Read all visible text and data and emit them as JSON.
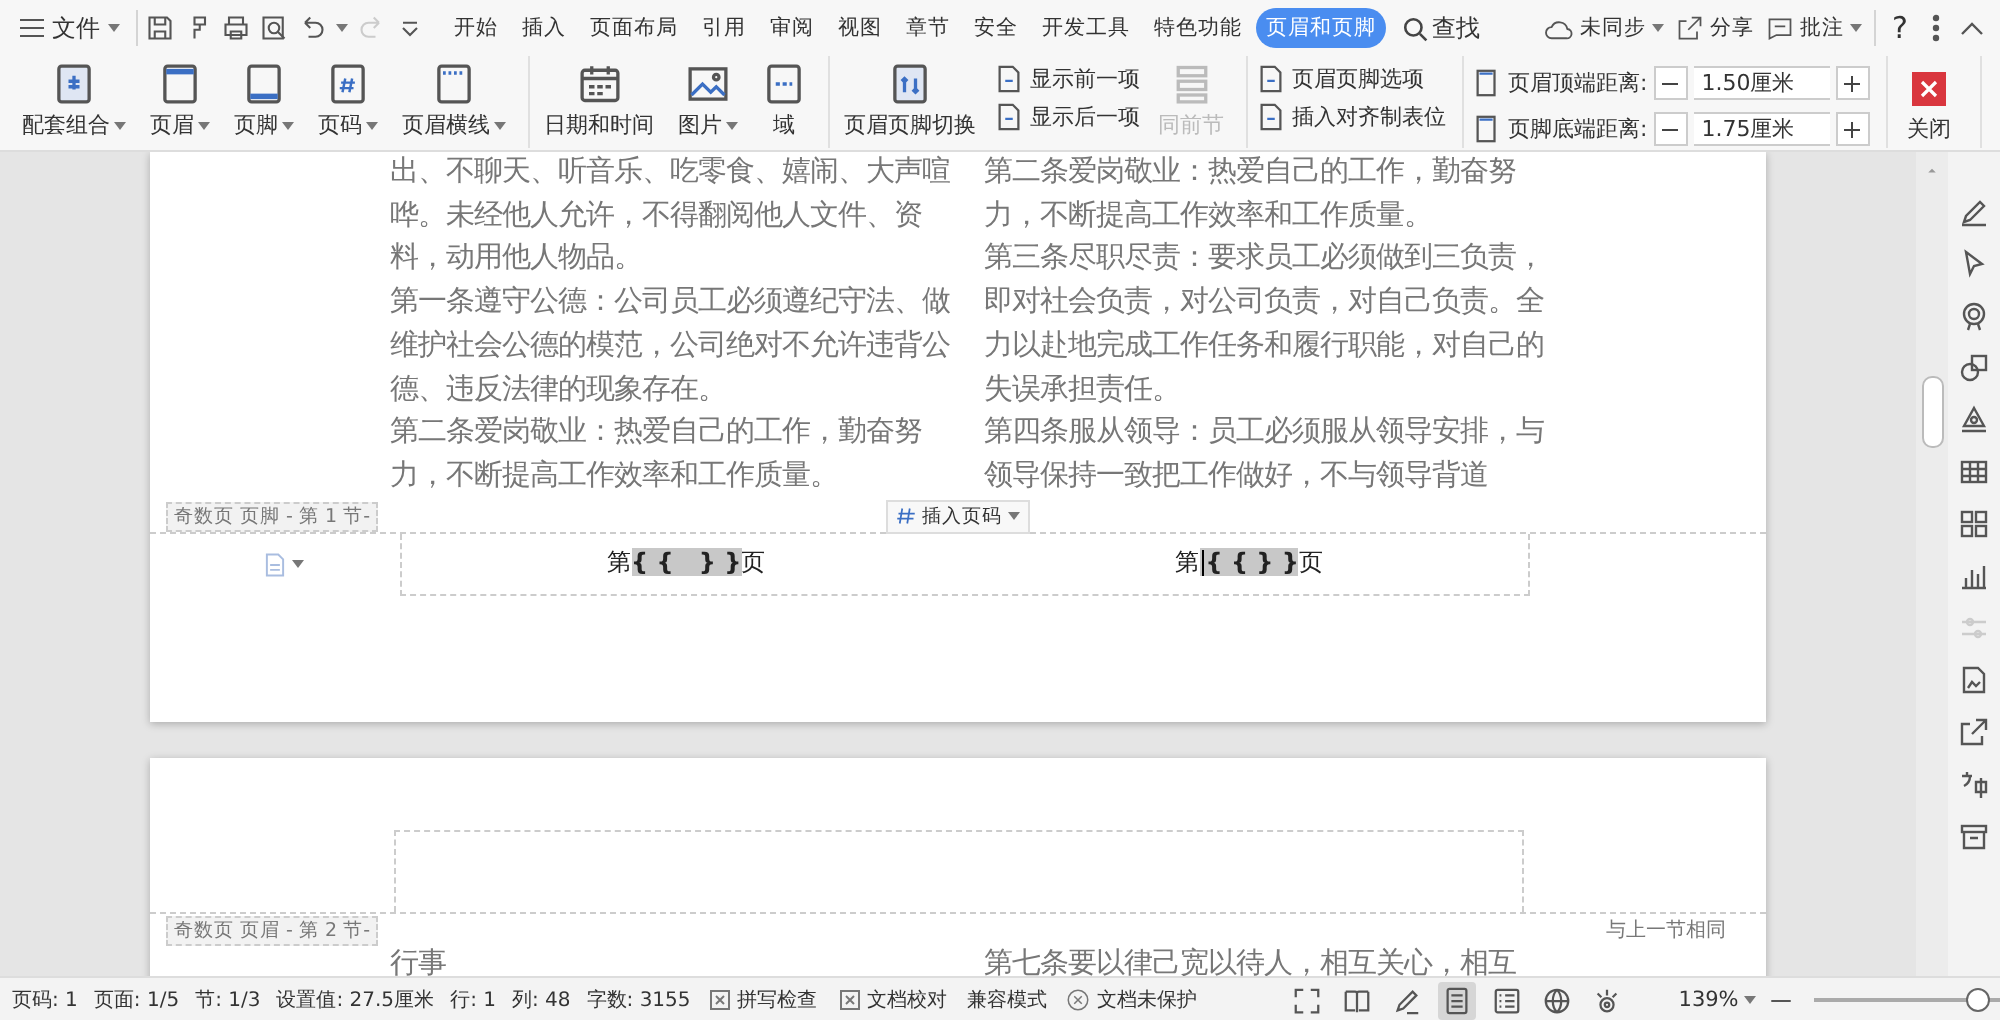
{
  "menu": {
    "file_label": "文件",
    "tabs": [
      {
        "label": "开始",
        "selected": false
      },
      {
        "label": "插入",
        "selected": false
      },
      {
        "label": "页面布局",
        "selected": false
      },
      {
        "label": "引用",
        "selected": false
      },
      {
        "label": "审阅",
        "selected": false
      },
      {
        "label": "视图",
        "selected": false
      },
      {
        "label": "章节",
        "selected": false
      },
      {
        "label": "安全",
        "selected": false
      },
      {
        "label": "开发工具",
        "selected": false
      },
      {
        "label": "特色功能",
        "selected": false
      },
      {
        "label": "页眉和页脚",
        "selected": true
      }
    ],
    "find_label": "查找",
    "sync_label": "未同步",
    "share_label": "分享",
    "comment_label": "批注",
    "help_glyph": "?"
  },
  "ribbon": {
    "groups": [
      {
        "items": [
          {
            "kind": "big",
            "label": "配套组合",
            "dropdown": true,
            "disabled": false
          },
          {
            "kind": "big",
            "label": "页眉",
            "dropdown": true,
            "disabled": false
          },
          {
            "kind": "big",
            "label": "页脚",
            "dropdown": true,
            "disabled": false
          },
          {
            "kind": "big",
            "label": "页码",
            "dropdown": true,
            "disabled": false
          },
          {
            "kind": "big",
            "label": "页眉横线",
            "dropdown": true,
            "disabled": false
          }
        ]
      },
      {
        "items": [
          {
            "kind": "big",
            "label": "日期和时间",
            "dropdown": false,
            "disabled": false
          },
          {
            "kind": "big",
            "label": "图片",
            "dropdown": true,
            "disabled": false
          },
          {
            "kind": "big",
            "label": "域",
            "dropdown": false,
            "disabled": false
          }
        ]
      },
      {
        "items": [
          {
            "kind": "big",
            "label": "页眉页脚切换",
            "dropdown": false,
            "disabled": false
          },
          {
            "kind": "stack",
            "buttons": [
              {
                "label": "显示前一项",
                "disabled": false
              },
              {
                "label": "显示后一项",
                "disabled": false
              }
            ]
          },
          {
            "kind": "big",
            "label": "同前节",
            "dropdown": false,
            "disabled": true
          }
        ]
      },
      {
        "items": [
          {
            "kind": "stack",
            "buttons": [
              {
                "label": "页眉页脚选项",
                "disabled": false
              },
              {
                "label": "插入对齐制表位",
                "disabled": false
              }
            ]
          }
        ]
      },
      {
        "items": [
          {
            "kind": "spin",
            "rows": [
              {
                "label": "页眉顶端距离:",
                "value": "1.50厘米"
              },
              {
                "label": "页脚底端距离:",
                "value": "1.75厘米"
              }
            ]
          }
        ]
      },
      {
        "items": [
          {
            "kind": "close",
            "label": "关闭"
          }
        ]
      }
    ]
  },
  "page1": {
    "left_paragraphs": [
      "出、不聊天、听音乐、吃零食、嬉闹、大声喧哗。未经他人允许，不得翻阅他人文件、资料，动用他人物品。",
      "第一条遵守公德：公司员工必须遵纪守法、做维护社会公德的模范，公司绝对不允许违背公德、违反法律的现象存在。",
      "第二条爱岗敬业：热爱自己的工作，勤奋努力，不断提高工作效率和工作质量。"
    ],
    "right_paragraphs": [
      "第二条爱岗敬业：热爱自己的工作，勤奋努力，不断提高工作效率和工作质量。",
      "第三条尽职尽责：要求员工必须做到三负责，即对社会负责，对公司负责，对自己负责。全力以赴地完成工作任务和履行职能，对自己的失误承担责任。",
      "第四条服从领导：员工必须服从领导安排，与领导保持一致把工作做好，不与领导背道"
    ],
    "footer_label": "奇数页 页脚 - 第 1 节-",
    "insert_page_number": "插入页码",
    "page_fields": [
      {
        "prefix": "第",
        "field": "{ {   } }",
        "suffix": "页",
        "text_cursor": false
      },
      {
        "prefix": "第",
        "field": "{ { } }",
        "suffix": "页",
        "text_cursor": true
      }
    ]
  },
  "page2": {
    "header_label": "奇数页 页眉 - 第 2 节-",
    "same_as_previous": "与上一节相同",
    "left_text": "行事",
    "right_text": "第七条要以律己宽以待人，相互关心，相互"
  },
  "status_bar": {
    "items": [
      "页码: 1",
      "页面: 1/5",
      "节: 1/3",
      "设置值: 27.5厘米",
      "行: 1",
      "列: 48",
      "字数: 3155"
    ],
    "checks": [
      "拼写检查",
      "文档校对"
    ],
    "mode": "兼容模式",
    "protection": "文档未保护",
    "views": [
      {
        "kind": "fullscreen",
        "selected": false
      },
      {
        "kind": "reading",
        "selected": false
      },
      {
        "kind": "edit",
        "selected": false
      },
      {
        "kind": "page",
        "selected": true
      },
      {
        "kind": "outline",
        "selected": false
      },
      {
        "kind": "web",
        "selected": false
      },
      {
        "kind": "eye",
        "selected": false
      }
    ],
    "zoom": "139%",
    "zoom_slider": {
      "level": 0.82
    }
  }
}
